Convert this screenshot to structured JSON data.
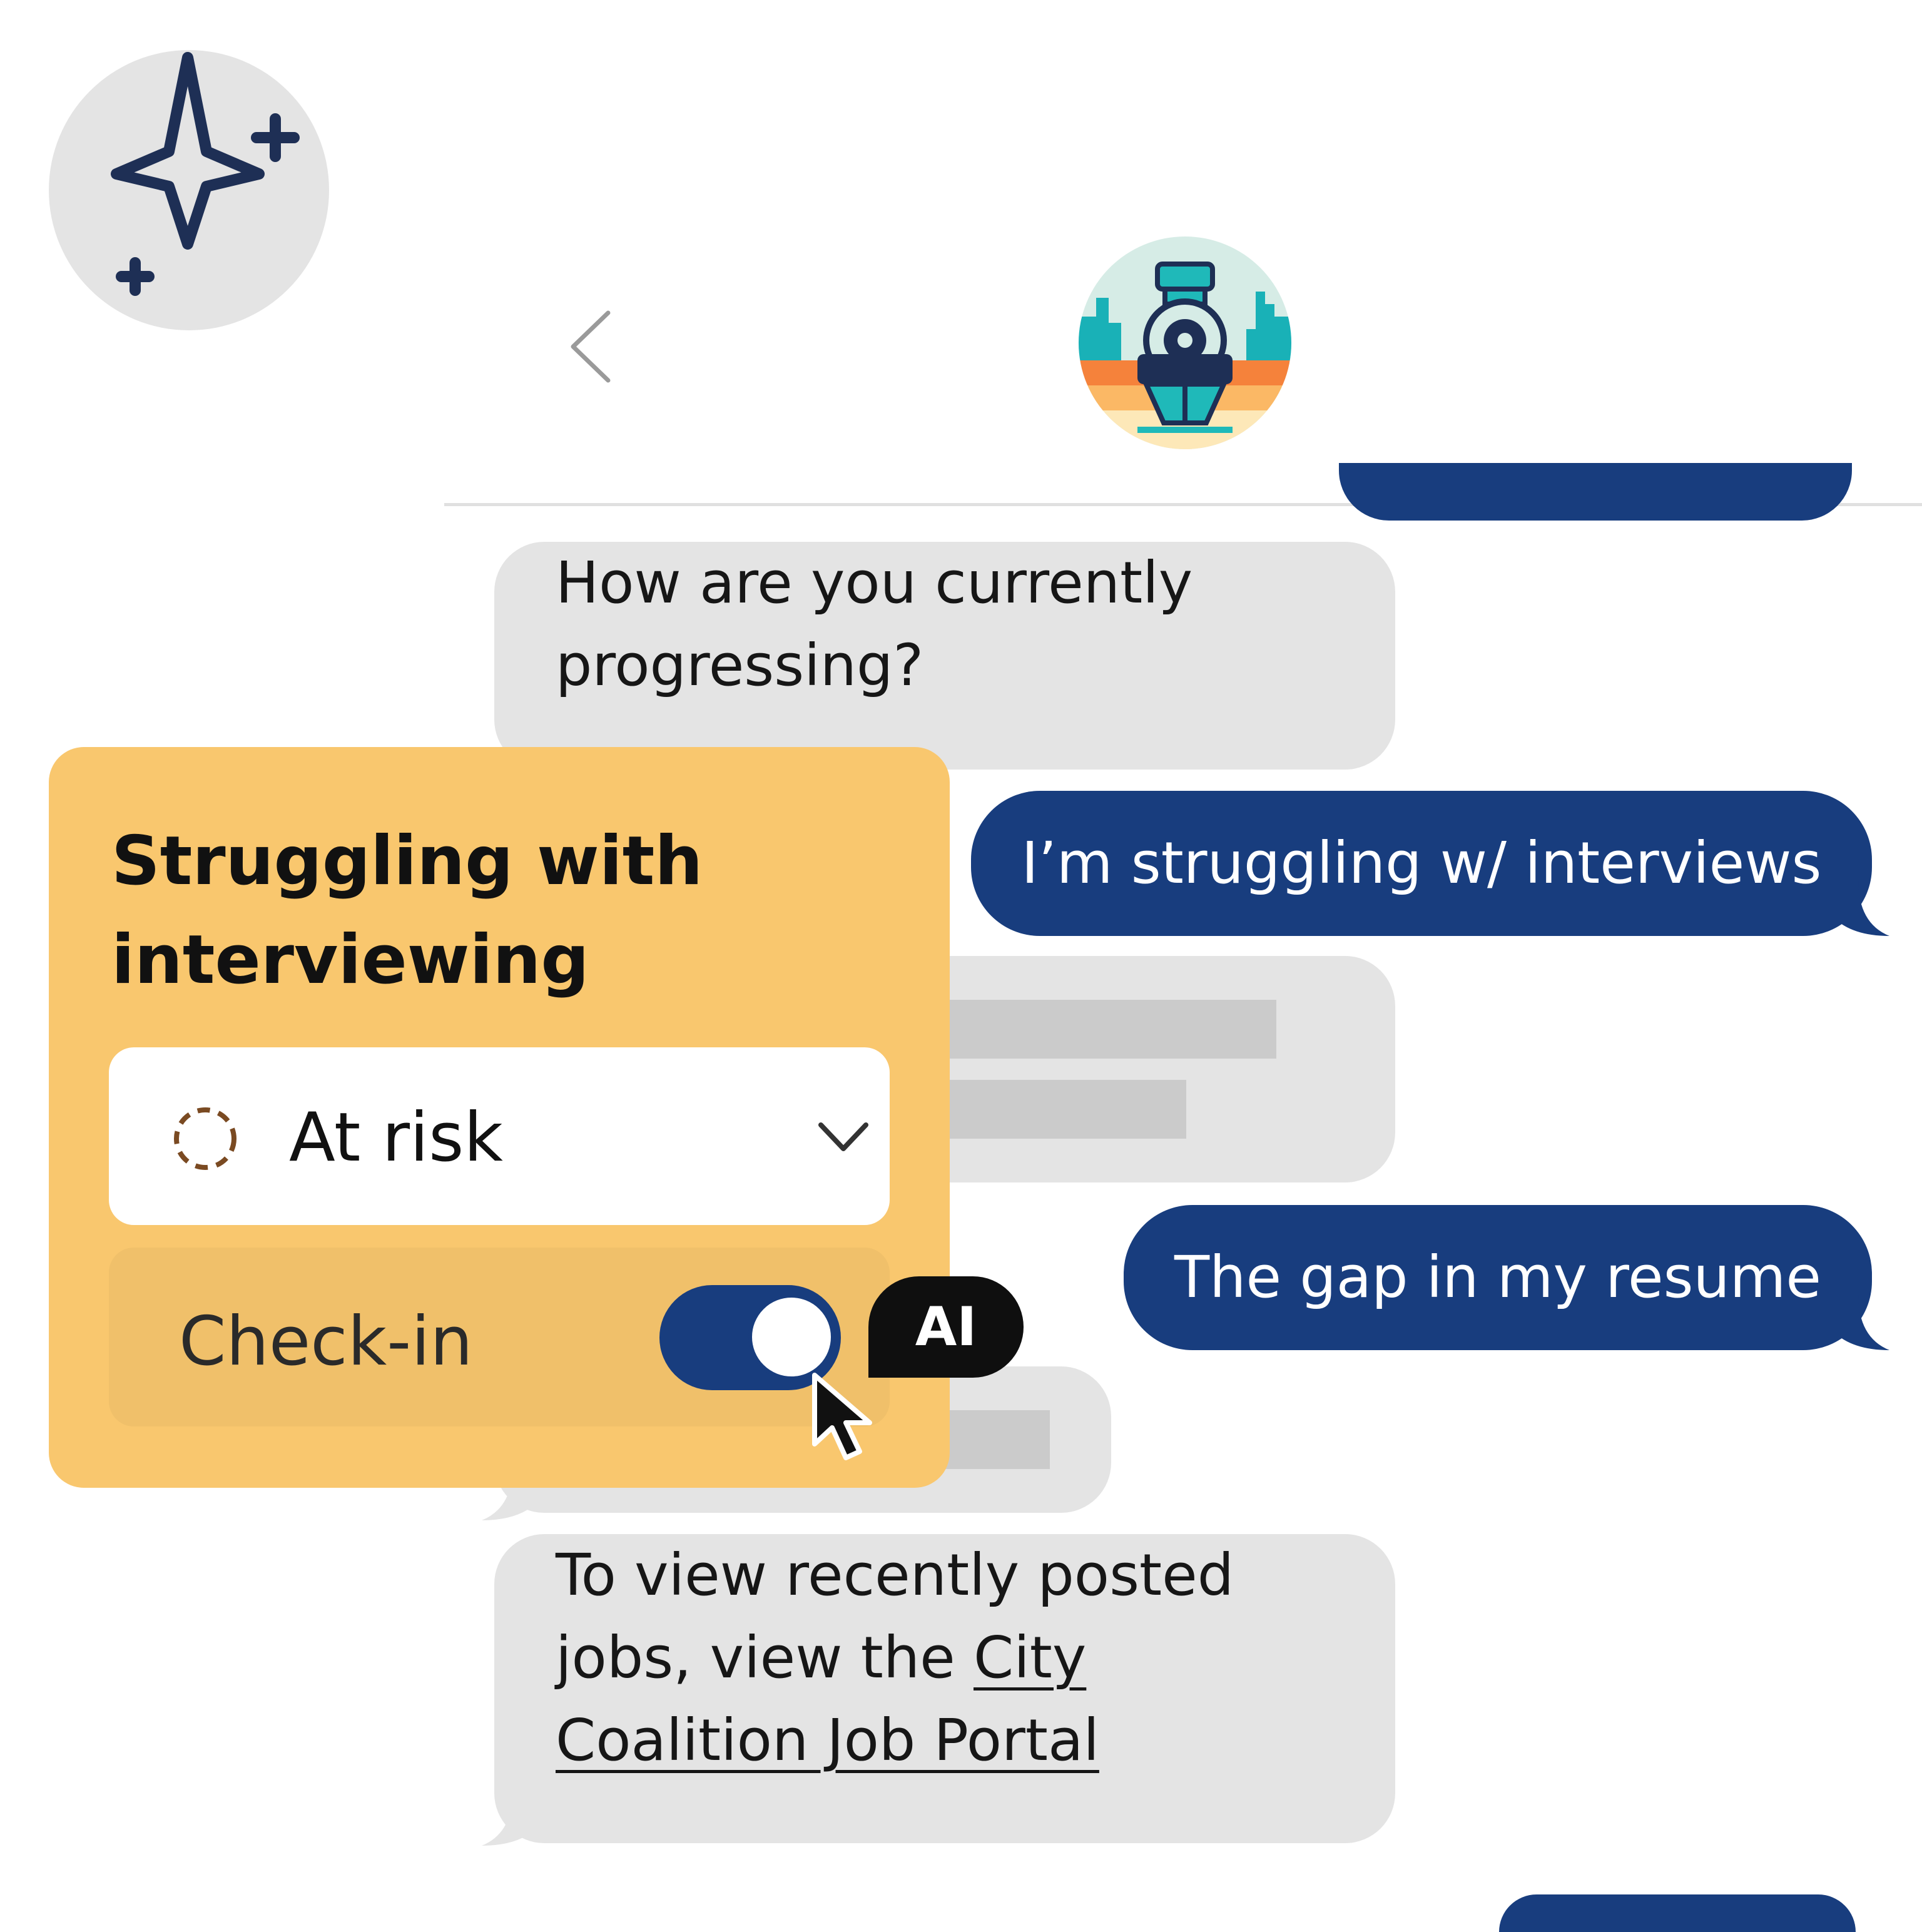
{
  "header": {
    "back_icon": "chevron-left-icon",
    "avatar_icon": "train-avatar-icon"
  },
  "ai_button_icon": "sparkle-icon",
  "messages": [
    {
      "side": "incoming",
      "text_lines": [
        "How are you currently",
        "progressing?"
      ]
    },
    {
      "side": "outgoing",
      "text": "I’m struggling w/ interviews"
    },
    {
      "side": "incoming",
      "placeholder": true
    },
    {
      "side": "outgoing",
      "text": "The gap in my resume"
    },
    {
      "side": "incoming",
      "placeholder": true
    },
    {
      "side": "incoming",
      "text_lines": [
        "To view recently posted",
        "jobs, view the "
      ],
      "link_text_1": "City",
      "link_text_2": "Coalition Job Portal"
    }
  ],
  "card": {
    "title_line1": "Struggling with",
    "title_line2": "interviewing",
    "status": {
      "value": "At risk",
      "icon": "dashed-circle-icon",
      "dropdown_icon": "chevron-down-icon"
    },
    "checkin": {
      "label": "Check-in",
      "enabled": true
    },
    "ai_badge": "AI"
  },
  "colors": {
    "brand_navy": "#183d7e",
    "card_yellow": "#f9c76e",
    "bubble_gray": "#e4e4e4",
    "at_risk_brown": "#7a4a22"
  }
}
